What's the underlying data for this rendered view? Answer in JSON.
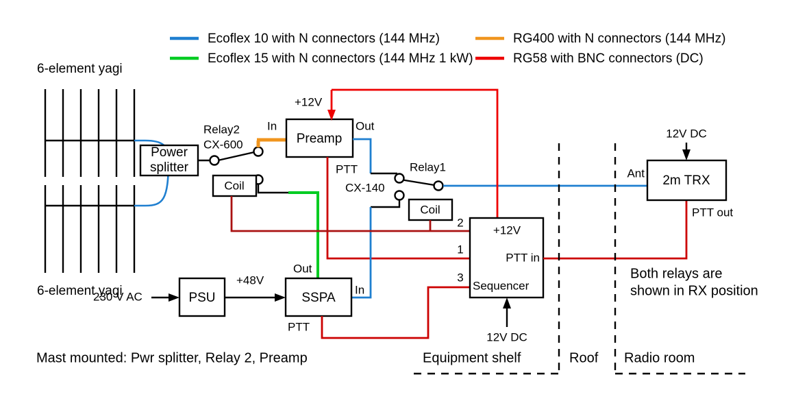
{
  "legend": {
    "items": [
      {
        "label": "Ecoflex 10 with N connectors (144 MHz)",
        "color": "#1f7fd0"
      },
      {
        "label": "Ecoflex 15 with N connectors (144 MHz 1 kW)",
        "color": "#00cc22"
      },
      {
        "label": "RG400 with N connectors (144 MHz)",
        "color": "#f0951e"
      },
      {
        "label": "RG58 with BNC connectors (DC)",
        "color": "#ee0000"
      }
    ]
  },
  "antennas": {
    "top_label": "6-element yagi",
    "bottom_label": "6-element yagi",
    "element_count": 6
  },
  "blocks": {
    "power_splitter": {
      "line1": "Power",
      "line2": "splitter"
    },
    "preamp": {
      "label": "Preamp"
    },
    "coil_left": {
      "label": "Coil"
    },
    "coil_right": {
      "label": "Coil"
    },
    "psu": {
      "label": "PSU"
    },
    "sspa": {
      "label": "SSPA"
    },
    "sequencer": {
      "top": "+12V",
      "mid": "PTT in",
      "bottom": "Sequencer"
    },
    "trx": {
      "label": "2m TRX"
    }
  },
  "labels": {
    "relay2_name": "Relay2",
    "relay2_model": "CX-600",
    "relay1_name": "Relay1",
    "relay1_model": "CX-140",
    "preamp_supply": "+12V",
    "preamp_in": "In",
    "preamp_out": "Out",
    "preamp_ptt": "PTT",
    "sspa_out": "Out",
    "sspa_in": "In",
    "sspa_ptt": "PTT",
    "psu_input": "230 V AC",
    "psu_output": "+48V",
    "seq_pin2": "2",
    "seq_pin1": "1",
    "seq_pin3": "3",
    "seq_supply": "12V DC",
    "trx_supply": "12V DC",
    "trx_ant": "Ant",
    "trx_ptt_out": "PTT out"
  },
  "notes": {
    "relays_note_line1": "Both relays are",
    "relays_note_line2": "shown in RX position",
    "mast_note": "Mast mounted: Pwr splitter, Relay 2, Preamp"
  },
  "zones": {
    "equipment_shelf": "Equipment shelf",
    "roof": "Roof",
    "radio_room": "Radio room"
  },
  "colors": {
    "ecoflex10": "#1f7fd0",
    "ecoflex15": "#00cc22",
    "rg400": "#f0951e",
    "rg58": "#ee0000",
    "rg58_dark": "#aa1111",
    "black": "#000000"
  }
}
